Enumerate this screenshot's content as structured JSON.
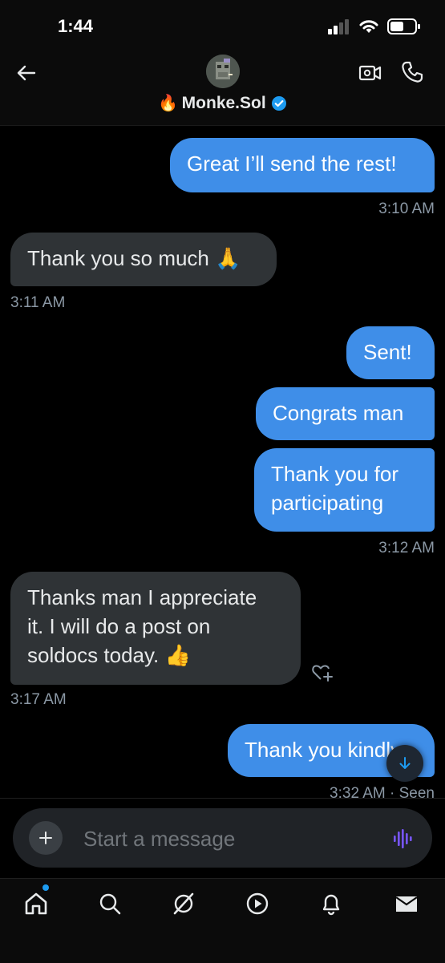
{
  "status_bar": {
    "time": "1:44"
  },
  "header": {
    "contact_name": "Monke.Sol",
    "name_prefix_emoji": "🔥"
  },
  "messages": [
    {
      "dir": "sent",
      "text": "Great I’ll send the rest!"
    },
    {
      "dir": "sent",
      "time": "3:10 AM"
    },
    {
      "dir": "received",
      "text": "Thank you so much 🙏"
    },
    {
      "dir": "received",
      "time": "3:11 AM"
    },
    {
      "dir": "sent",
      "text": "Sent!"
    },
    {
      "dir": "sent",
      "text": "Congrats man"
    },
    {
      "dir": "sent",
      "text_line1": "Thank you for",
      "text_line2": "participating"
    },
    {
      "dir": "sent",
      "time": "3:12 AM"
    },
    {
      "dir": "received",
      "text_line1": "Thanks man I appreciate",
      "text_line2": "it. I will do a post on",
      "text_line3": "soldocs today. 👍"
    },
    {
      "dir": "received",
      "time": "3:17 AM"
    },
    {
      "dir": "sent",
      "text": "Thank you kindly"
    },
    {
      "dir": "sent",
      "time": "3:32 AM · Seen"
    }
  ],
  "composer": {
    "placeholder": "Start a message"
  },
  "colors": {
    "sent_bubble": "#3f8ee8",
    "received_bubble": "#2f3336",
    "accent": "#1d9bf0",
    "background": "#000000"
  },
  "icons": [
    "back-arrow-icon",
    "video-call-icon",
    "phone-icon",
    "verified-badge-icon",
    "heart-add-icon",
    "scroll-down-icon",
    "plus-icon",
    "voice-icon",
    "home-icon",
    "search-icon",
    "grok-icon",
    "video-icon",
    "notifications-icon",
    "messages-icon"
  ]
}
